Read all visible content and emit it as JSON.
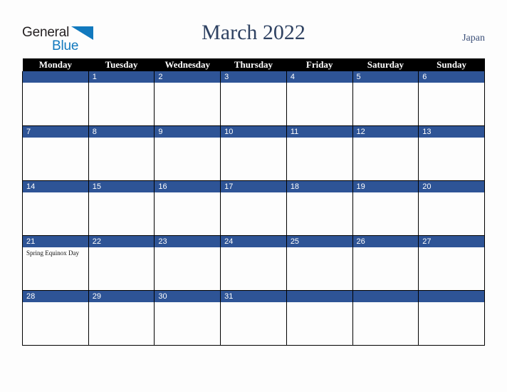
{
  "brand": {
    "name_part1": "General",
    "name_part2": "Blue",
    "triangle_icon": "triangle-icon"
  },
  "header": {
    "title": "March 2022",
    "country": "Japan"
  },
  "colors": {
    "header_bar": "#000000",
    "day_band": "#2e5496",
    "title_text": "#2f4262",
    "brand_blue": "#1179be",
    "page_background": "#fdfdfd"
  },
  "calendar": {
    "month": "March",
    "year": "2022",
    "weekday_headers": [
      "Monday",
      "Tuesday",
      "Wednesday",
      "Thursday",
      "Friday",
      "Saturday",
      "Sunday"
    ],
    "weeks": [
      [
        {
          "day": "",
          "events": []
        },
        {
          "day": "1",
          "events": []
        },
        {
          "day": "2",
          "events": []
        },
        {
          "day": "3",
          "events": []
        },
        {
          "day": "4",
          "events": []
        },
        {
          "day": "5",
          "events": []
        },
        {
          "day": "6",
          "events": []
        }
      ],
      [
        {
          "day": "7",
          "events": []
        },
        {
          "day": "8",
          "events": []
        },
        {
          "day": "9",
          "events": []
        },
        {
          "day": "10",
          "events": []
        },
        {
          "day": "11",
          "events": []
        },
        {
          "day": "12",
          "events": []
        },
        {
          "day": "13",
          "events": []
        }
      ],
      [
        {
          "day": "14",
          "events": []
        },
        {
          "day": "15",
          "events": []
        },
        {
          "day": "16",
          "events": []
        },
        {
          "day": "17",
          "events": []
        },
        {
          "day": "18",
          "events": []
        },
        {
          "day": "19",
          "events": []
        },
        {
          "day": "20",
          "events": []
        }
      ],
      [
        {
          "day": "21",
          "events": [
            "Spring Equinox Day"
          ]
        },
        {
          "day": "22",
          "events": []
        },
        {
          "day": "23",
          "events": []
        },
        {
          "day": "24",
          "events": []
        },
        {
          "day": "25",
          "events": []
        },
        {
          "day": "26",
          "events": []
        },
        {
          "day": "27",
          "events": []
        }
      ],
      [
        {
          "day": "28",
          "events": []
        },
        {
          "day": "29",
          "events": []
        },
        {
          "day": "30",
          "events": []
        },
        {
          "day": "31",
          "events": []
        },
        {
          "day": "",
          "events": []
        },
        {
          "day": "",
          "events": []
        },
        {
          "day": "",
          "events": []
        }
      ]
    ]
  }
}
